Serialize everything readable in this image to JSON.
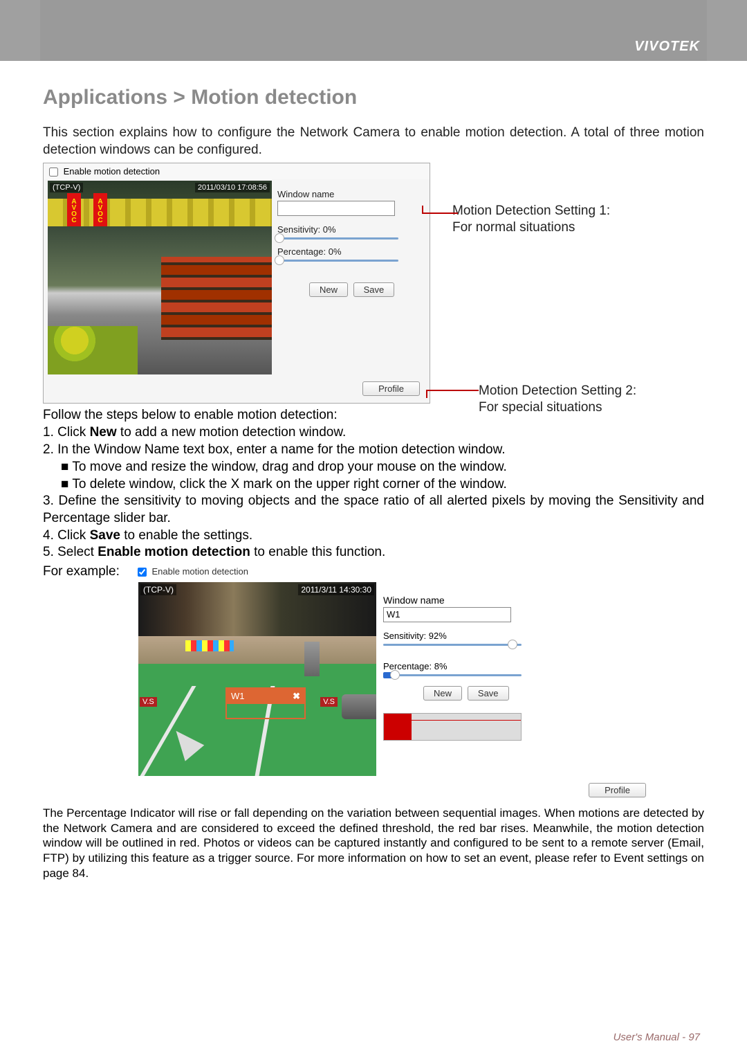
{
  "brand": "VIVOTEK",
  "title": "Applications > Motion detection",
  "intro": "This section explains how to configure the Network Camera to enable motion detection. A total of three motion detection windows can be configured.",
  "dialog1": {
    "enable_label": "Enable motion detection",
    "overlay_tl": "(TCP-V)",
    "overlay_tr": "2011/03/10 17:08:56",
    "sign": "AVOC",
    "window_name_label": "Window name",
    "window_name_value": "",
    "sensitivity_label": "Sensitivity: 0%",
    "sensitivity_pct": 0,
    "percentage_label": "Percentage: 0%",
    "percentage_pct": 0,
    "new_btn": "New",
    "save_btn": "Save",
    "profile_btn": "Profile"
  },
  "annot1": {
    "l1": "Motion Detection Setting 1:",
    "l2": "For normal situations"
  },
  "annot2": {
    "l1": "Motion Detection Setting 2:",
    "l2": "For special situations"
  },
  "follow": "Follow the steps below to enable motion detection:",
  "steps": {
    "s1a": "1. Click ",
    "s1b": "New",
    "s1c": " to add a new motion detection window.",
    "s2": "2. In the Window Name text box, enter a name for the motion detection window.",
    "s2a": "■ To move and resize the window, drag and drop your mouse on the window.",
    "s2b": "■ To delete window, click the X mark on the upper right corner of the window.",
    "s3": "3. Define the sensitivity to moving objects and the space ratio of all alerted pixels by moving the Sensitivity and Percentage slider bar.",
    "s4a": "4. Click ",
    "s4b": "Save",
    "s4c": " to enable the settings.",
    "s5a": "5. Select ",
    "s5b": "Enable motion detection",
    "s5c": " to enable this function."
  },
  "for_example": "For example:",
  "dialog2": {
    "enable_label": "Enable motion detection",
    "overlay_tl": "(TCP-V)",
    "overlay_tr": "2011/3/11 14:30:30",
    "vs": "V.S",
    "motion_win_name": "W1",
    "close_char": "✖",
    "window_name_label": "Window name",
    "window_name_value": "W1",
    "sensitivity_label": "Sensitivity: 92%",
    "sensitivity_pct": 92,
    "percentage_label": "Percentage: 8%",
    "percentage_pct": 8,
    "new_btn": "New",
    "save_btn": "Save",
    "profile_btn": "Profile",
    "redbar_height_pct": 100
  },
  "note": "The Percentage Indicator will rise or fall depending on the variation between sequential images. When motions are detected by the Network Camera and are considered to exceed the defined threshold, the red bar rises. Meanwhile, the motion detection window will be outlined in red. Photos or videos can be captured instantly and configured to be sent to a remote server (Email, FTP) by utilizing this feature as a trigger source. For more information on how to set an event, please refer to Event settings on page 84.",
  "footer": {
    "label": "User's Manual - ",
    "page": "97"
  }
}
